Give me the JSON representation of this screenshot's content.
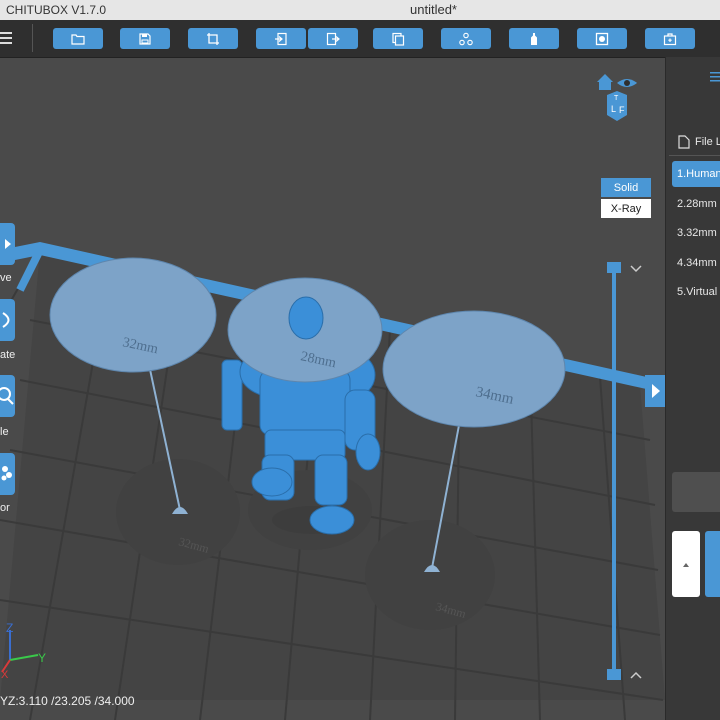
{
  "window": {
    "app_title": "CHITUBOX V1.7.0",
    "document_title": "untitled*"
  },
  "toolbar": {
    "buttons": [
      {
        "name": "open-folder",
        "icon": "folder-icon"
      },
      {
        "name": "save",
        "icon": "save-icon"
      },
      {
        "name": "crop",
        "icon": "crop-icon"
      },
      {
        "name": "import",
        "icon": "import-icon"
      },
      {
        "name": "export",
        "icon": "export-icon"
      },
      {
        "name": "copy",
        "icon": "copy-icon"
      },
      {
        "name": "layout",
        "icon": "network-icon"
      },
      {
        "name": "support",
        "icon": "bottle-icon"
      },
      {
        "name": "hollow",
        "icon": "hollow-icon"
      },
      {
        "name": "slice",
        "icon": "briefcase-icon"
      }
    ]
  },
  "left_tools": [
    {
      "label": "ve",
      "icon": "move-icon"
    },
    {
      "label": "ate",
      "icon": "rotate-icon"
    },
    {
      "label": "le",
      "icon": "scale-icon"
    },
    {
      "label": "or",
      "icon": "mirror-icon"
    }
  ],
  "view": {
    "modes": {
      "solid": "Solid",
      "xray": "X-Ray"
    },
    "active_mode": "Solid"
  },
  "scene": {
    "discs": [
      {
        "label": "32mm"
      },
      {
        "label": "28mm"
      },
      {
        "label": "34mm"
      }
    ],
    "shadow_labels": [
      "32mm",
      "34mm"
    ]
  },
  "axes": {
    "x": "X",
    "y": "Y",
    "z": "Z"
  },
  "status": {
    "xyz": "YZ:3.110 /23.205 /34.000"
  },
  "side_panel": {
    "file_list_header": "File L",
    "files": [
      "1.Human",
      "2.28mm",
      "3.32mm",
      "4.34mm",
      "5.Virtual"
    ],
    "selected_index": 0
  },
  "colors": {
    "accent": "#4a97d5",
    "viewport_bg": "#4a4a4a",
    "model": "#3b8fd8",
    "disc": "#7da3c8"
  }
}
